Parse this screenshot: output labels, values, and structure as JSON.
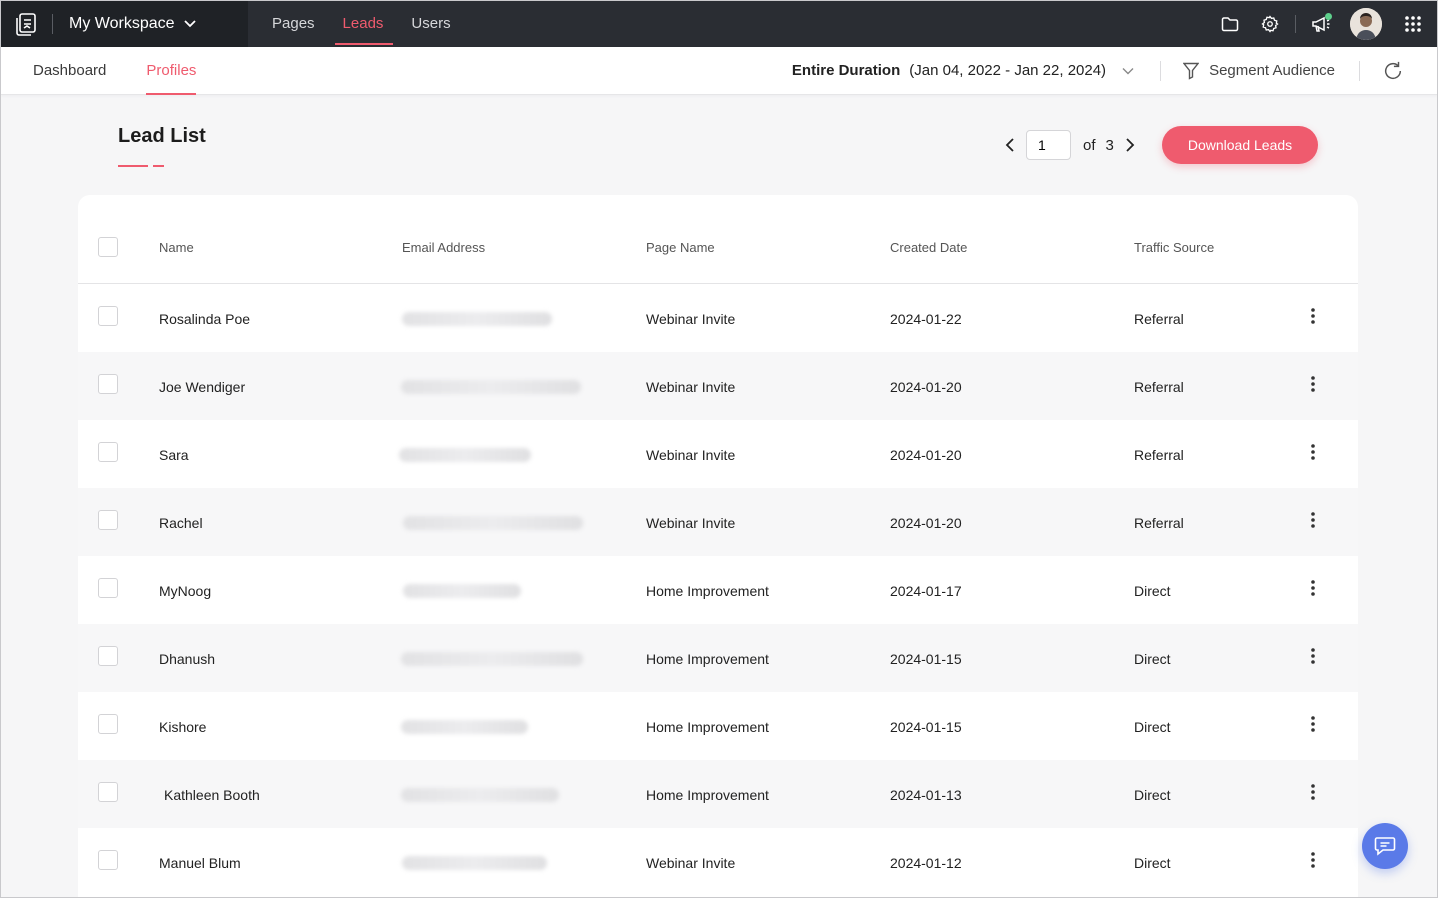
{
  "topbar": {
    "workspace": "My Workspace",
    "tabs": [
      {
        "label": "Pages",
        "active": false
      },
      {
        "label": "Leads",
        "active": true
      },
      {
        "label": "Users",
        "active": false
      }
    ],
    "icons": [
      "folder-icon",
      "gear-icon",
      "megaphone-icon",
      "avatar",
      "apps-grid-icon"
    ],
    "accent": "#ef5b6e",
    "background": "#2a2d33"
  },
  "subbar": {
    "tabs": [
      {
        "label": "Dashboard",
        "active": false
      },
      {
        "label": "Profiles",
        "active": true
      }
    ],
    "duration_label": "Entire Duration",
    "duration_range": "(Jan 04, 2022 - Jan 22, 2024)",
    "segment_label": "Segment Audience"
  },
  "content": {
    "title": "Lead List",
    "pager": {
      "current": "1",
      "of_label": "of",
      "total": "3"
    },
    "download_label": "Download Leads"
  },
  "table": {
    "headers": [
      "Name",
      "Email Address",
      "Page Name",
      "Created Date",
      "Traffic Source"
    ],
    "rows": [
      {
        "name": "Rosalinda Poe",
        "page": "Webinar Invite",
        "date": "2024-01-22",
        "source": "Referral"
      },
      {
        "name": "Joe Wendiger",
        "page": "Webinar Invite",
        "date": "2024-01-20",
        "source": "Referral"
      },
      {
        "name": "Sara",
        "page": "Webinar Invite",
        "date": "2024-01-20",
        "source": "Referral"
      },
      {
        "name": "Rachel",
        "page": "Webinar Invite",
        "date": "2024-01-20",
        "source": "Referral"
      },
      {
        "name": "MyNoog",
        "page": "Home Improvement",
        "date": "2024-01-17",
        "source": "Direct"
      },
      {
        "name": "Dhanush",
        "page": "Home Improvement",
        "date": "2024-01-15",
        "source": "Direct"
      },
      {
        "name": "Kishore",
        "page": "Home Improvement",
        "date": "2024-01-15",
        "source": "Direct"
      },
      {
        "name": "Kathleen Booth",
        "page": "Home Improvement",
        "date": "2024-01-13",
        "source": "Direct"
      },
      {
        "name": "Manuel Blum",
        "page": "Webinar Invite",
        "date": "2024-01-12",
        "source": "Direct"
      }
    ]
  }
}
